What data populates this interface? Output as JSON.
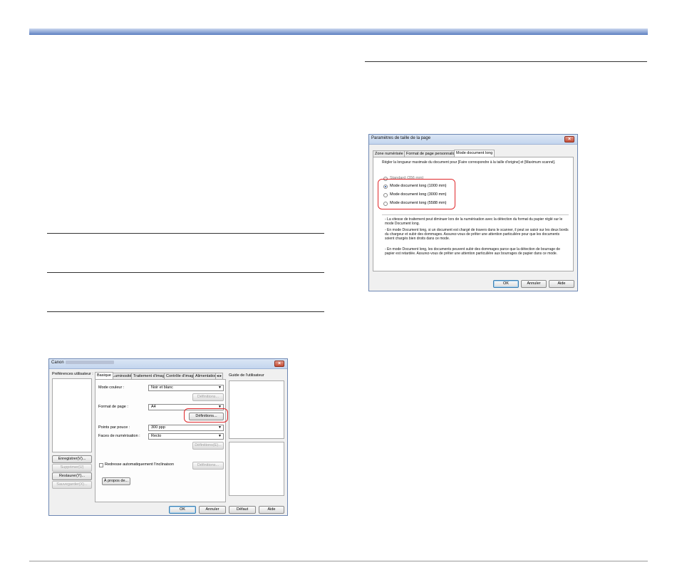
{
  "dialog_scanner": {
    "title_prefix": "Canon",
    "left": {
      "prefs_label": "Préférences utilisateur :",
      "save_button": "Enregistrer(V)...",
      "delete_button": "Supprimer(U)",
      "restore_button": "Restaurer(Y)...",
      "backup_button": "Sauvegarder(X)..."
    },
    "tabs": [
      "Basique",
      "Luminosité",
      "Traitement d'image",
      "Contrôle d'image",
      "Alimentation"
    ],
    "tab_scroll": "◂ ▸",
    "color_mode_label": "Mode couleur :",
    "color_mode_value": "Noir et blanc",
    "color_settings_button": "Définitions...",
    "page_size_label": "Format de page :",
    "page_size_value": "A4",
    "page_settings_button": "Définitions...",
    "dpi_label": "Points par pouce :",
    "dpi_value": "300 ppp",
    "scan_side_label": "Faces de numérisation :",
    "scan_side_value": "Recto",
    "scan_side_settings_button": "Définitions(E)...",
    "deskew_label": "Redresse automatiquement l'inclinaison",
    "deskew_settings_button": "Définitions...",
    "about_button": "À propos de...",
    "guide_label": "Guide de l'utilisateur",
    "ok_button": "OK",
    "cancel_button": "Annuler",
    "default_button": "Défaut",
    "help_button": "Aide"
  },
  "dialog_page_size": {
    "title": "Paramètres de taille de la page",
    "tabs": [
      "Zone numérisée",
      "Format de page personnalisé",
      "Mode document long"
    ],
    "description": "Régler la longueur maximale du document pour [Faire correspondre à la taille d'origine] et [Maximum scanné].",
    "options": [
      {
        "label": "Standard (356 mm)",
        "selected": false
      },
      {
        "label": "Mode document long (1000 mm)",
        "selected": true
      },
      {
        "label": "Mode document long (3000 mm)",
        "selected": false
      },
      {
        "label": "Mode document long (5588 mm)",
        "selected": false
      }
    ],
    "notes": [
      "- La vitesse de traitement peut diminuer lors de la numérisation avec la détection du format du papier réglé sur le mode Document long.",
      "- En mode Document long, si un document est chargé de travers dans le scanner, il peut se saisir sur les deux bords du chargeur et subir des dommages. Assurez-vous de prêter une attention particulière pour que les documents soient chargés bien droits dans ce mode.",
      "- En mode Document long, les documents peuvent subir des dommages parce que la détection de bourrage de papier est retardée. Assurez-vous de prêter une attention particulière aux bourrages de papier dans ce mode."
    ],
    "ok_button": "OK",
    "cancel_button": "Annuler",
    "help_button": "Aide"
  },
  "colors": {
    "highlight": "#e0282b",
    "header_bar": "#5a7cbf"
  }
}
